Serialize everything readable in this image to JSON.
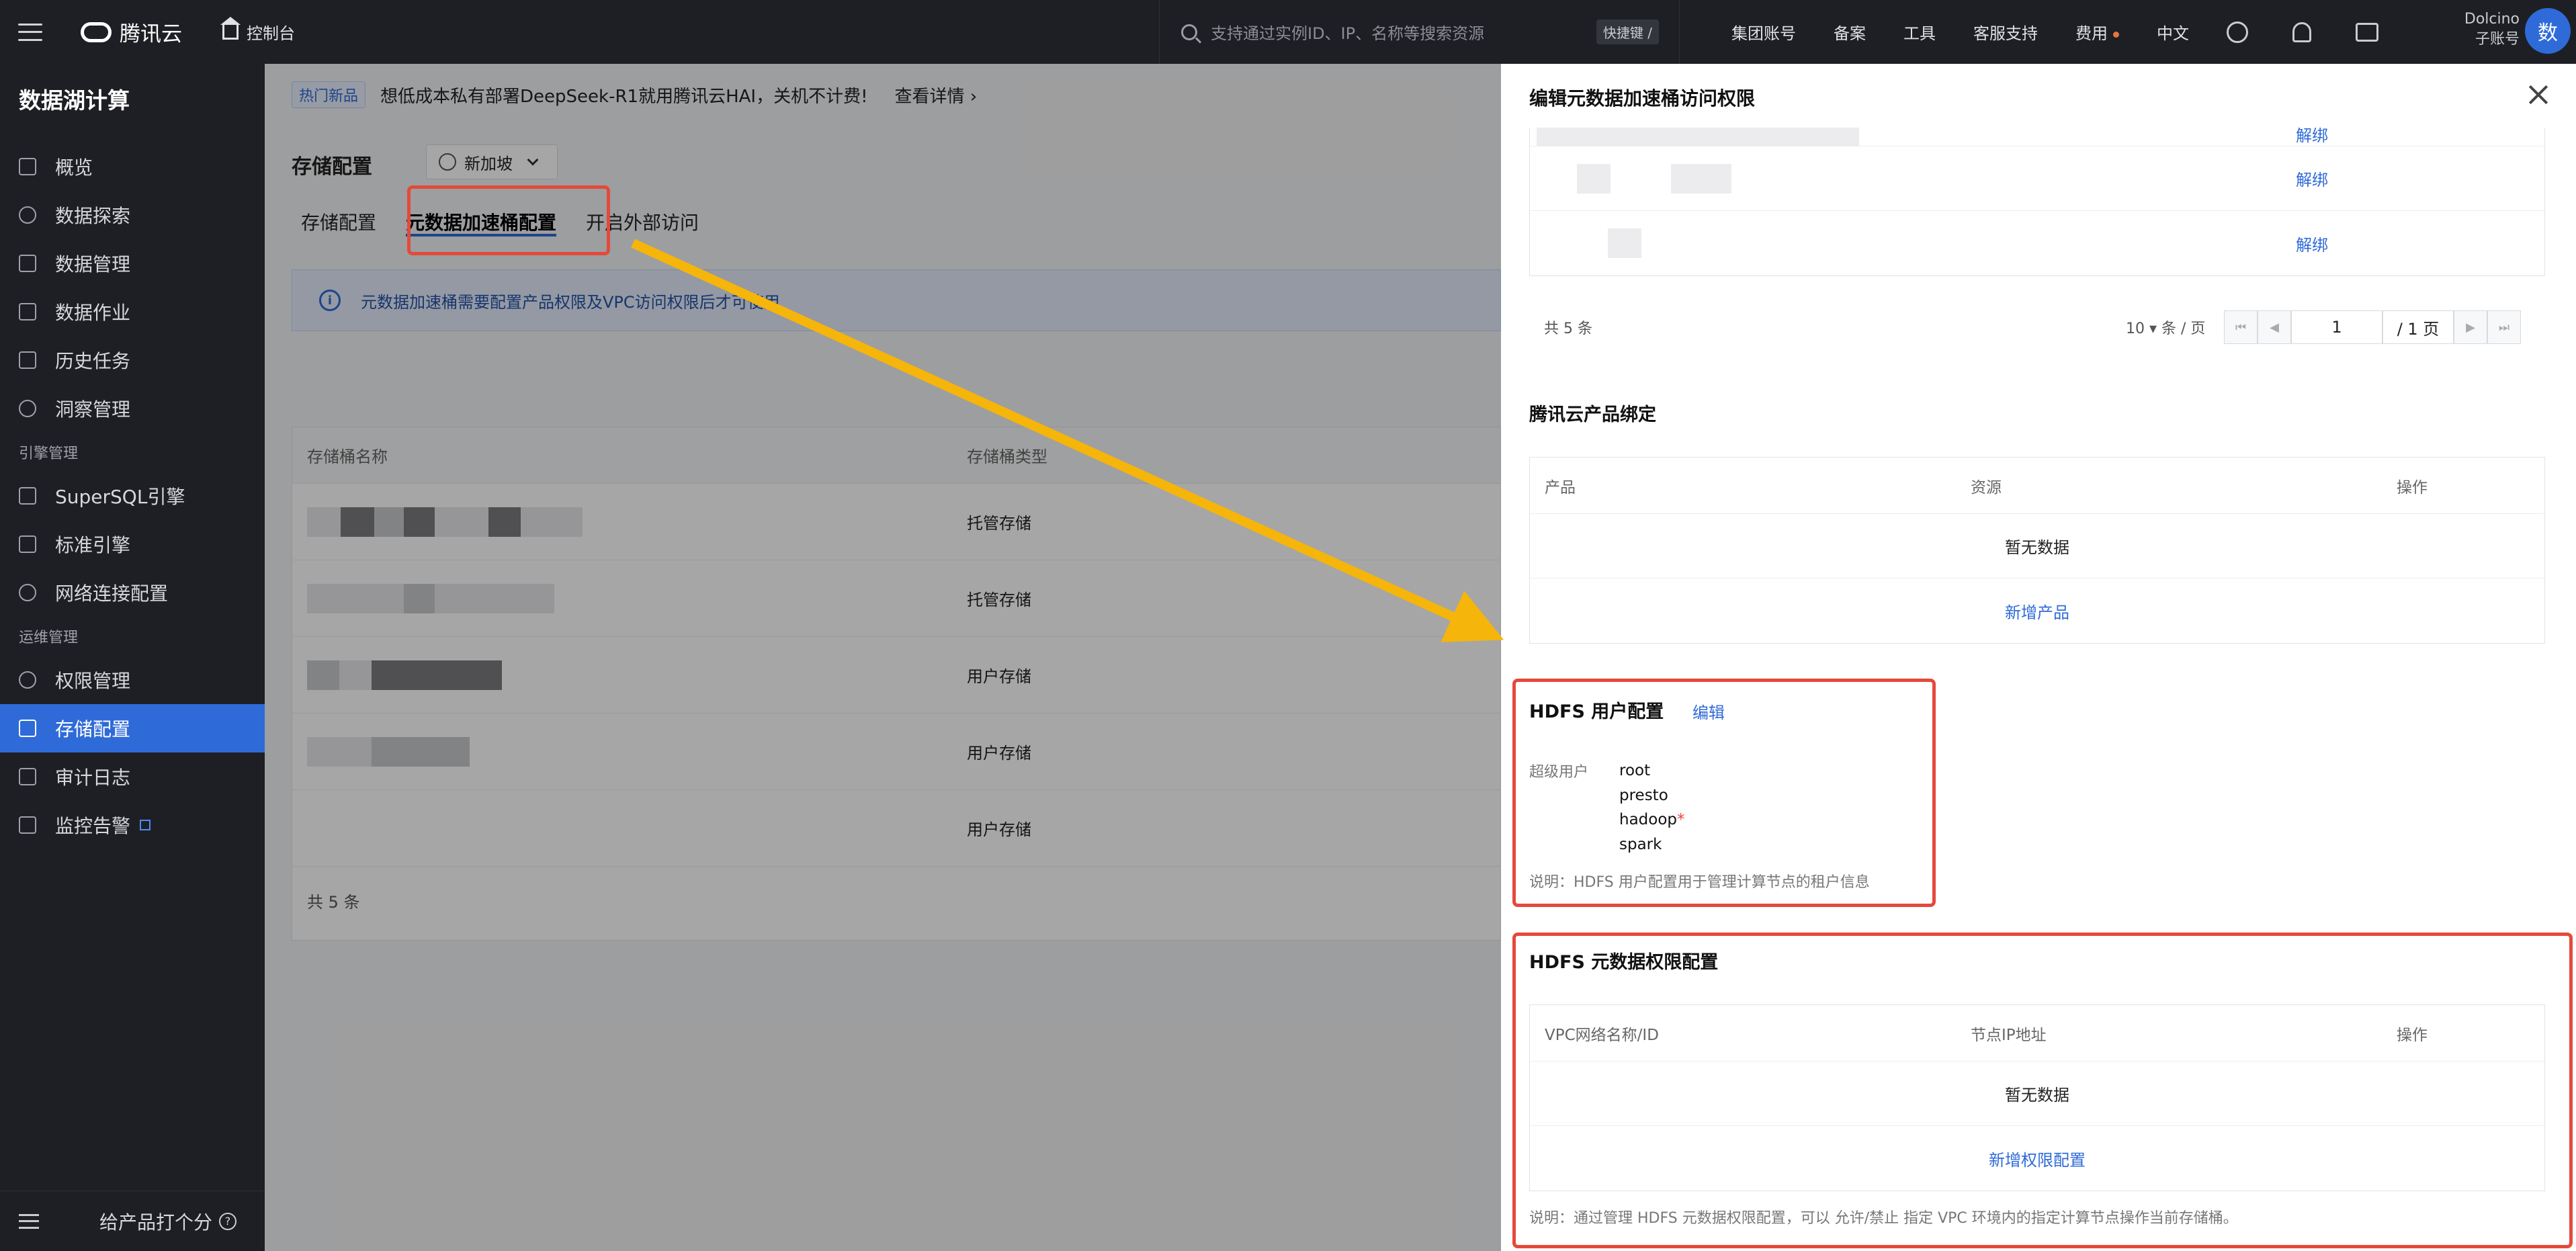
{
  "topbar": {
    "brand": "腾讯云",
    "console": "控制台",
    "search_placeholder": "支持通过实例ID、IP、名称等搜索资源",
    "shortcut": "快捷键 /",
    "nav": [
      "集团账号",
      "备案",
      "工具",
      "客服支持",
      "费用",
      "中文"
    ],
    "user_name": "Dolcino",
    "user_role": "子账号",
    "avatar": "数"
  },
  "sidebar": {
    "product_title": "数据湖计算",
    "items_top": [
      "概览",
      "数据探索",
      "数据管理",
      "数据作业",
      "历史任务",
      "洞察管理"
    ],
    "group_engine": "引擎管理",
    "items_engine": [
      "SuperSQL引擎",
      "标准引擎",
      "网络连接配置"
    ],
    "group_ops": "运维管理",
    "items_ops": [
      "权限管理",
      "存储配置",
      "审计日志",
      "监控告警"
    ],
    "active": "存储配置",
    "feedback": "给产品打个分"
  },
  "main": {
    "hot_tag": "热门新品",
    "banner_text": "想低成本私有部署DeepSeek-R1就用腾讯云HAI，关机不计费!",
    "banner_link": "查看详情 ›",
    "page_title": "存储配置",
    "region": "新加坡",
    "tabs": [
      "存储配置",
      "元数据加速桶配置",
      "开启外部访问"
    ],
    "active_tab": "元数据加速桶配置",
    "info": "元数据加速桶需要配置产品权限及VPC访问权限后才可使用",
    "table": {
      "headers": [
        "存储桶名称",
        "存储桶类型"
      ],
      "types": [
        "托管存储",
        "托管存储",
        "用户存储",
        "用户存储",
        "用户存储"
      ],
      "footer": "共 5 条"
    }
  },
  "drawer": {
    "title": "编辑元数据加速桶访问权限",
    "unbind": "解绑",
    "pager": {
      "count": "共 5 条",
      "page_size": "10",
      "per_page": "条 / 页",
      "page": "1",
      "total_pages": "/ 1 页"
    },
    "product_section": {
      "title": "腾讯云产品绑定",
      "headers": [
        "产品",
        "资源",
        "操作"
      ],
      "empty": "暂无数据",
      "add": "新增产品"
    },
    "hdfs_user": {
      "title": "HDFS 用户配置",
      "edit": "编辑",
      "label": "超级用户",
      "users": [
        "root",
        "presto",
        "hadoop",
        "spark"
      ],
      "required_user": "hadoop",
      "note": "说明：HDFS 用户配置用于管理计算节点的租户信息"
    },
    "hdfs_perm": {
      "title": "HDFS 元数据权限配置",
      "headers": [
        "VPC网络名称/ID",
        "节点IP地址",
        "操作"
      ],
      "empty": "暂无数据",
      "add": "新增权限配置",
      "note": "说明：通过管理 HDFS 元数据权限配置，可以 允许/禁止 指定 VPC 环境内的指定计算节点操作当前存储桶。"
    }
  },
  "colors": {
    "accent": "#2f6bd8",
    "highlight": "#e5493a",
    "arrow": "#f5b50a",
    "dark": "#1e1f24"
  }
}
